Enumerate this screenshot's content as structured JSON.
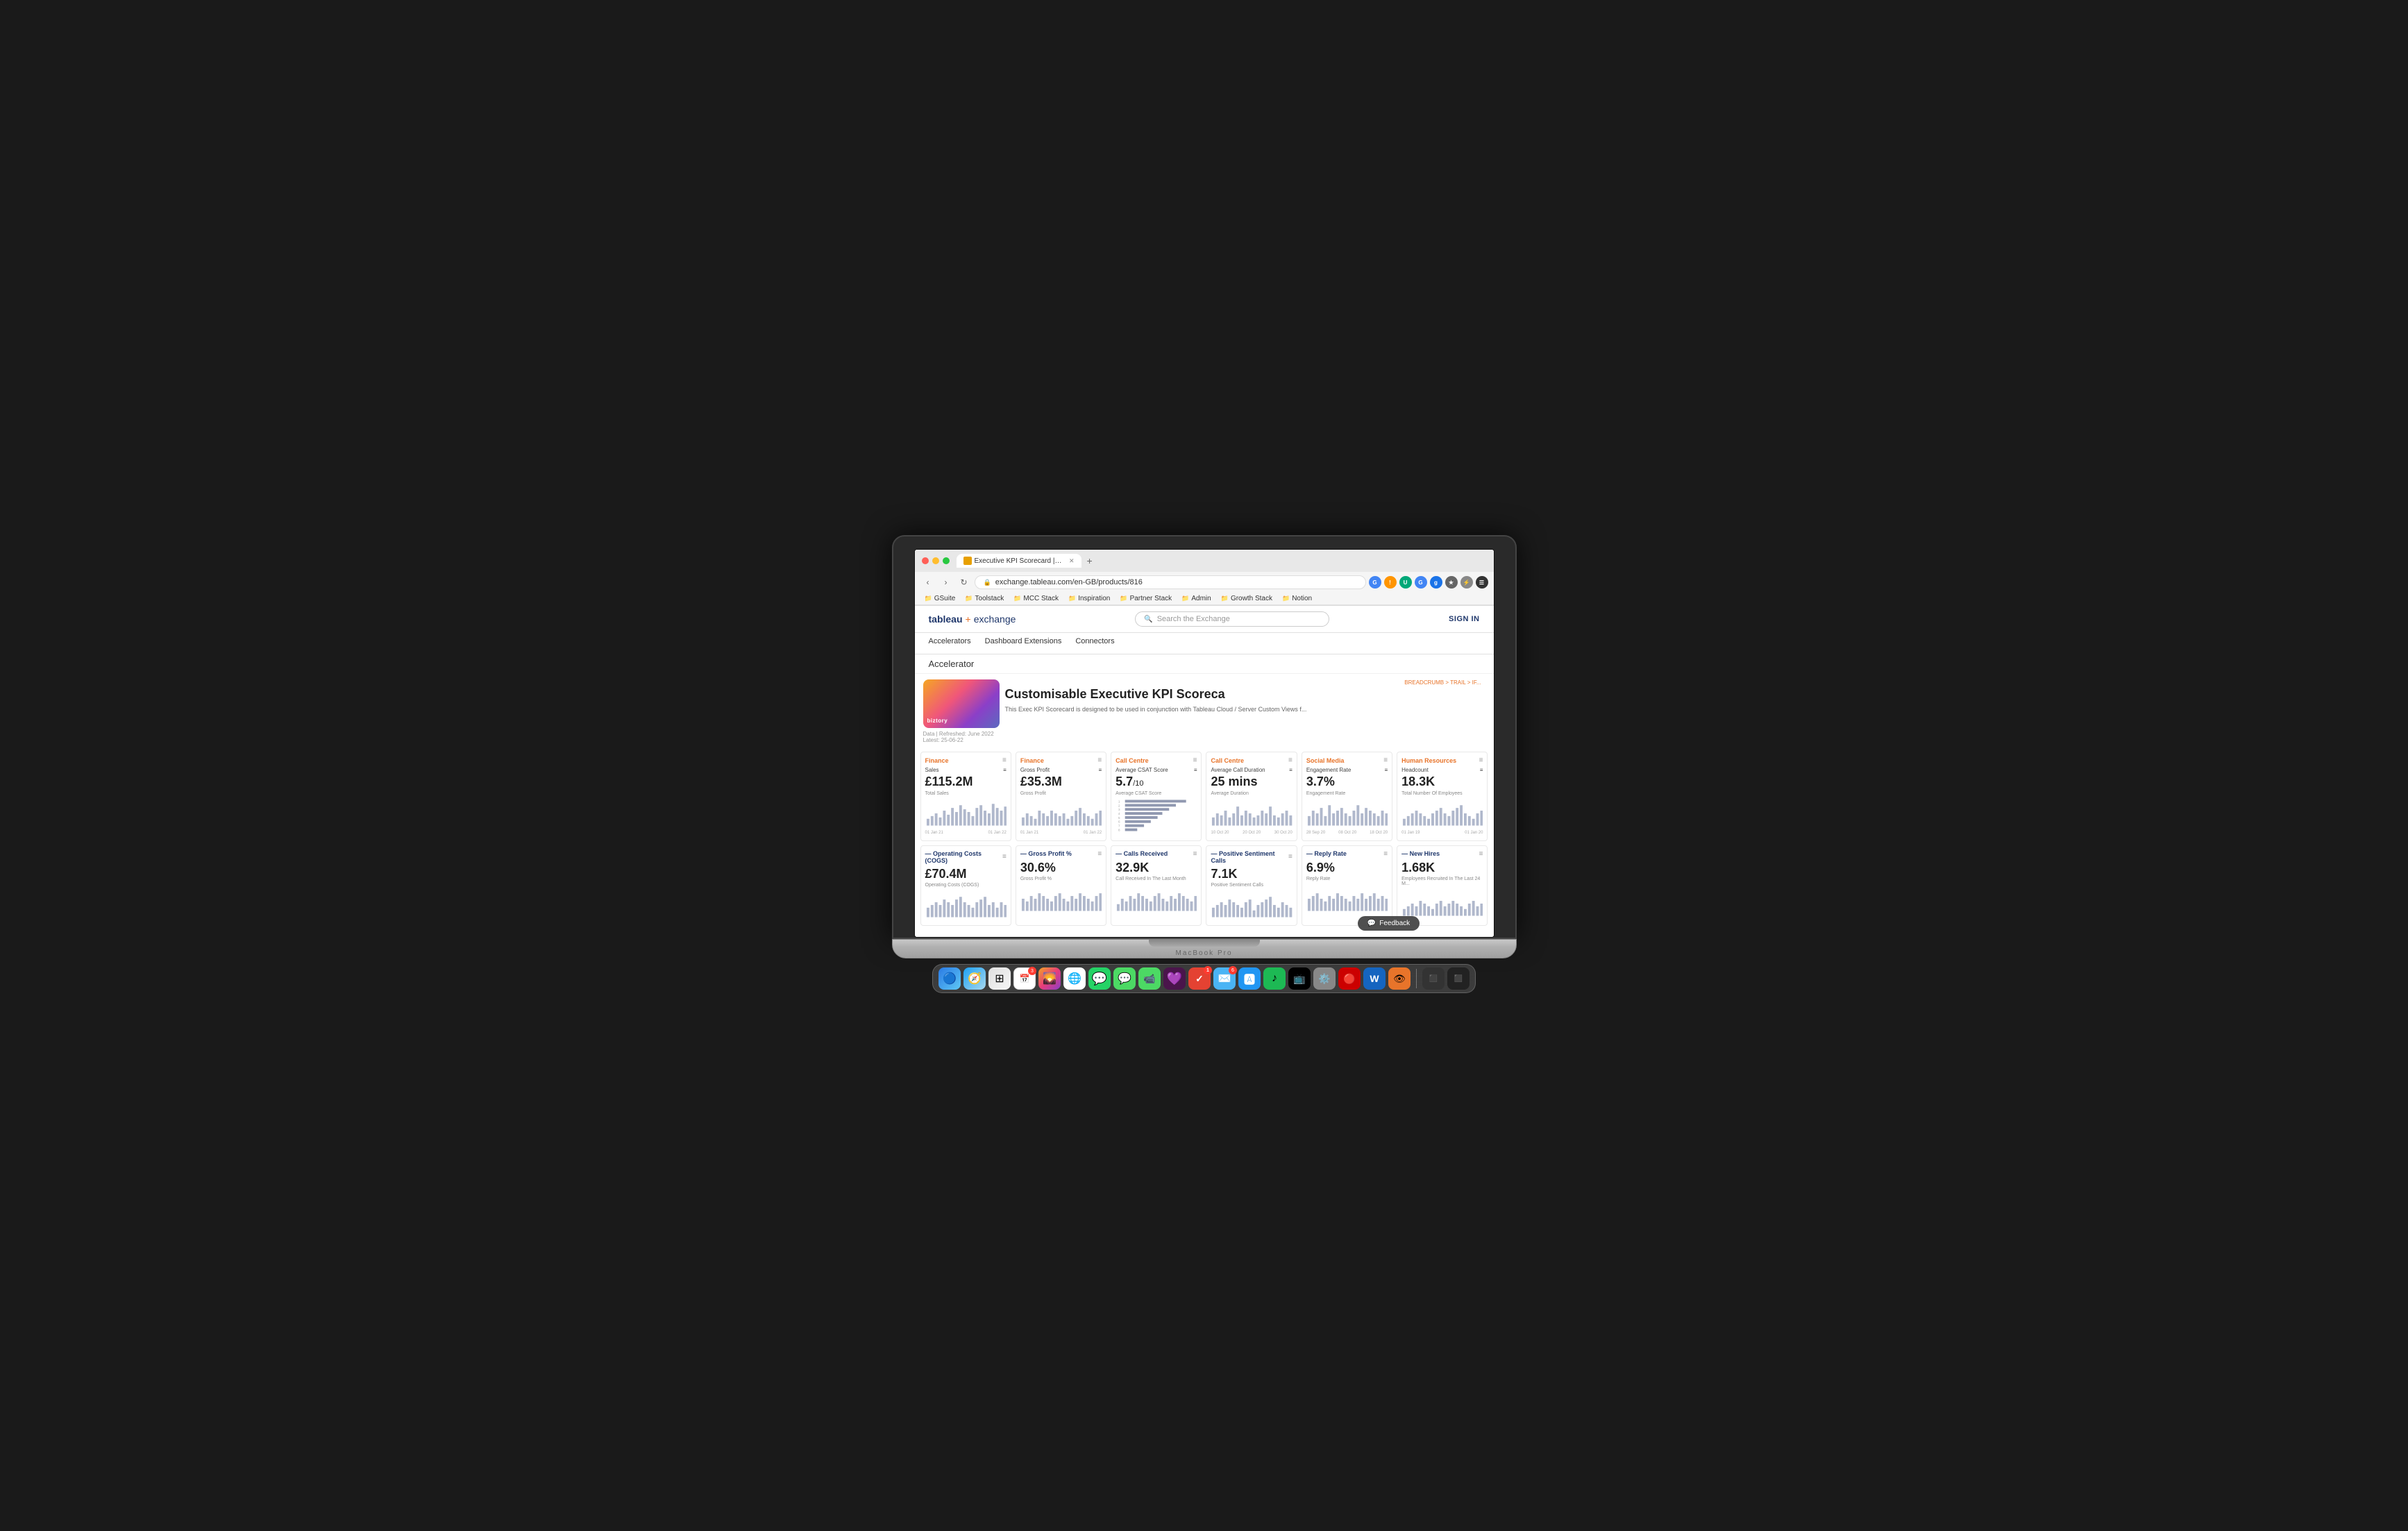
{
  "laptop": {
    "model": "MacBook Pro"
  },
  "browser": {
    "tab_title": "Executive KPI Scorecard | Tabl...",
    "url": "exchange.tableau.com/en-GB/products/816",
    "bookmarks": [
      {
        "label": "GSuite",
        "icon": "📁"
      },
      {
        "label": "Toolstack",
        "icon": "📁"
      },
      {
        "label": "MCC Stack",
        "icon": "📁"
      },
      {
        "label": "Inspiration",
        "icon": "📁"
      },
      {
        "label": "Partner Stack",
        "icon": "📁"
      },
      {
        "label": "Admin",
        "icon": "📁"
      },
      {
        "label": "Growth Stack",
        "icon": "📁"
      },
      {
        "label": "Notion",
        "icon": "📁"
      }
    ]
  },
  "tableau_header": {
    "logo_word": "tableau",
    "logo_plus": "+",
    "logo_exchange": "exchange",
    "search_placeholder": "Search the Exchange",
    "sign_in": "SIGN IN"
  },
  "nav": {
    "tabs": [
      "Accelerators",
      "Dashboard Extensions",
      "Connectors"
    ]
  },
  "page": {
    "section": "Accelerator",
    "breadcrumb": "BREADCRUMB > TRAIL > IF...",
    "product_title": "Customisable Executive KPI Scoreca",
    "product_description": "This Exec KPI Scorecard is designed to be used in conjunction with Tableau Cloud / Server Custom Views f...",
    "data_refreshed": "Data | Refreshed: June 2022  Latest: 25-06-22",
    "biztory_label": "biztory"
  },
  "dashboard": {
    "rows": [
      {
        "cards": [
          {
            "section": "Finance",
            "section_color": "orange",
            "metric": "Sales",
            "value": "£115.2M",
            "sublabel": "Total Sales",
            "chart_type": "bar",
            "date_range": [
              "01 Jan 21",
              "01 Jan 22"
            ],
            "bars": [
              3,
              4,
              5,
              3,
              6,
              4,
              7,
              5,
              8,
              6,
              5,
              4,
              7,
              8,
              6,
              5,
              9,
              7,
              6,
              8
            ]
          },
          {
            "section": "Finance",
            "section_color": "orange",
            "metric": "Gross Profit",
            "value": "£35.3M",
            "sublabel": "Gross Profit",
            "chart_type": "bar",
            "date_range": [
              "01 Jan 21",
              "01 Jan 22"
            ],
            "bars": [
              3,
              5,
              4,
              3,
              6,
              5,
              4,
              6,
              5,
              4,
              5,
              3,
              4,
              6,
              7,
              5,
              4,
              3,
              5,
              6
            ]
          },
          {
            "section": "Call Centre",
            "section_color": "orange",
            "metric": "Average CSAT Score",
            "value": "5.7",
            "value_suffix": "/10",
            "sublabel": "Average CSAT Score",
            "chart_type": "hbar",
            "hbars": [
              90,
              80,
              70,
              60,
              50,
              40,
              30,
              20,
              10,
              8
            ],
            "hbar_labels": [
              "1",
              "2",
              "3",
              "4",
              "5",
              "6",
              "7",
              "8",
              "9",
              "10"
            ]
          },
          {
            "section": "Call Centre",
            "section_color": "orange",
            "metric": "Average Call Duration",
            "value": "25 mins",
            "sublabel": "Average Call Duration",
            "chart_type": "bar",
            "date_range": [
              "10 Oct 20",
              "20 Oct 20",
              "30 Oct 20"
            ],
            "bars": [
              5,
              7,
              6,
              8,
              5,
              7,
              9,
              6,
              8,
              7,
              5,
              6,
              8,
              7,
              9,
              6,
              5,
              7,
              8,
              6
            ]
          },
          {
            "section": "Social Media",
            "section_color": "orange",
            "metric": "Engagement Rate",
            "value": "3.7%",
            "sublabel": "Engagement Rate",
            "chart_type": "bar",
            "date_range": [
              "28 Sep 20",
              "08 Oct 20",
              "18 Oct 20"
            ],
            "bars": [
              4,
              6,
              5,
              7,
              4,
              8,
              5,
              6,
              7,
              5,
              4,
              6,
              8,
              5,
              7,
              6,
              5,
              4,
              6,
              5
            ]
          },
          {
            "section": "Human Resources",
            "section_color": "orange",
            "metric": "Headcount",
            "value": "18.3K",
            "sublabel": "Total Number Of Employees",
            "chart_type": "bar",
            "date_range": [
              "01 Jan 19",
              "01 Jan 20"
            ],
            "bars": [
              3,
              4,
              5,
              6,
              5,
              4,
              3,
              5,
              6,
              7,
              5,
              4,
              6,
              7,
              8,
              5,
              4,
              3,
              5,
              6
            ]
          }
        ]
      },
      {
        "cards": [
          {
            "section": "Operating Costs (COGS)",
            "section_color": "blue",
            "metric": "Operating Costs (COGS)",
            "value": "£70.4M",
            "sublabel": "Operating Costs (COGS)",
            "chart_type": "bar",
            "bars": [
              4,
              5,
              6,
              5,
              7,
              6,
              5,
              7,
              8,
              6,
              5,
              4,
              6,
              7,
              8,
              5,
              6,
              7,
              5,
              4
            ]
          },
          {
            "section": "Gross Profit %",
            "section_color": "blue",
            "metric": "Gross Profit %",
            "value": "30.6%",
            "sublabel": "Gross Profit %",
            "chart_type": "bar",
            "bars": [
              5,
              4,
              6,
              5,
              7,
              6,
              5,
              4,
              6,
              7,
              5,
              4,
              6,
              5,
              7,
              6,
              5,
              4,
              6,
              7
            ]
          },
          {
            "section": "Calls Received",
            "section_color": "blue",
            "metric": "Calls Received",
            "value": "32.9K",
            "sublabel": "Call Received In The Last Month",
            "chart_type": "bar",
            "bars": [
              3,
              5,
              4,
              6,
              5,
              7,
              6,
              5,
              4,
              6,
              7,
              5,
              4,
              6,
              5,
              7,
              6,
              5,
              4,
              6
            ]
          },
          {
            "section": "Positive Sentiment Calls",
            "section_color": "blue",
            "metric": "Positive Sentiment Calls",
            "value": "7.1K",
            "sublabel": "Positive Sentiment Calls",
            "chart_type": "bar",
            "bars": [
              4,
              5,
              6,
              5,
              7,
              6,
              5,
              4,
              6,
              7,
              5,
              4,
              3,
              5,
              6,
              7,
              5,
              4,
              6,
              5
            ]
          },
          {
            "section": "Reply Rate",
            "section_color": "blue",
            "metric": "Reply Rate",
            "value": "6.9%",
            "sublabel": "Reply Rate",
            "chart_type": "bar",
            "bars": [
              5,
              6,
              7,
              5,
              4,
              6,
              5,
              7,
              6,
              5,
              4,
              6,
              7,
              5,
              4,
              6,
              5,
              7,
              6,
              5
            ]
          },
          {
            "section": "New Hires",
            "section_color": "blue",
            "metric": "New Hires",
            "value": "1.68K",
            "sublabel": "Employees Recruited In The Last 24 M...",
            "chart_type": "bar",
            "bars": [
              3,
              4,
              5,
              4,
              6,
              5,
              4,
              3,
              5,
              6,
              4,
              5,
              6,
              5,
              4,
              3,
              5,
              6,
              4,
              5
            ]
          }
        ]
      }
    ]
  },
  "feedback": {
    "label": "Feedback",
    "icon": "💬"
  },
  "dock": {
    "icons": [
      {
        "label": "Finder",
        "color": "#2a7ae4",
        "symbol": "🔵"
      },
      {
        "label": "Safari",
        "color": "#1da1f2",
        "symbol": "🧭"
      },
      {
        "label": "Launchpad",
        "color": "#555",
        "symbol": "⊞"
      },
      {
        "label": "Calendar",
        "color": "#f00",
        "symbol": "📅",
        "badge": "3"
      },
      {
        "label": "Photos",
        "color": "#f5a623",
        "symbol": "🌄"
      },
      {
        "label": "Chrome",
        "color": "#4285f4",
        "symbol": "🌐"
      },
      {
        "label": "WhatsApp",
        "color": "#25d366",
        "symbol": "💬"
      },
      {
        "label": "Messages",
        "color": "#4cd964",
        "symbol": "💬"
      },
      {
        "label": "FaceTime",
        "color": "#4cd964",
        "symbol": "📹"
      },
      {
        "label": "Slack",
        "color": "#4a154b",
        "symbol": "💜"
      },
      {
        "label": "Todoist",
        "color": "#e44232",
        "symbol": "✓",
        "badge": "1"
      },
      {
        "label": "Mail",
        "color": "#4ab4f5",
        "symbol": "✉️",
        "badge": "6"
      },
      {
        "label": "AppStore",
        "color": "#2196f3",
        "symbol": "🅰"
      },
      {
        "label": "Spotify",
        "color": "#1db954",
        "symbol": "♪"
      },
      {
        "label": "TV",
        "color": "#000",
        "symbol": "📺"
      },
      {
        "label": "Settings",
        "color": "#888",
        "symbol": "⚙️"
      },
      {
        "label": "Unknown1",
        "color": "#c00",
        "symbol": "🔴"
      },
      {
        "label": "Office",
        "color": "#1565c0",
        "symbol": "W"
      },
      {
        "label": "Preview",
        "color": "#e8742a",
        "symbol": "👁"
      },
      {
        "label": "Screen1",
        "color": "#333",
        "symbol": "⬛"
      },
      {
        "label": "Screen2",
        "color": "#222",
        "symbol": "⬛"
      },
      {
        "label": "Screen3",
        "color": "#111",
        "symbol": "⬛"
      }
    ]
  }
}
